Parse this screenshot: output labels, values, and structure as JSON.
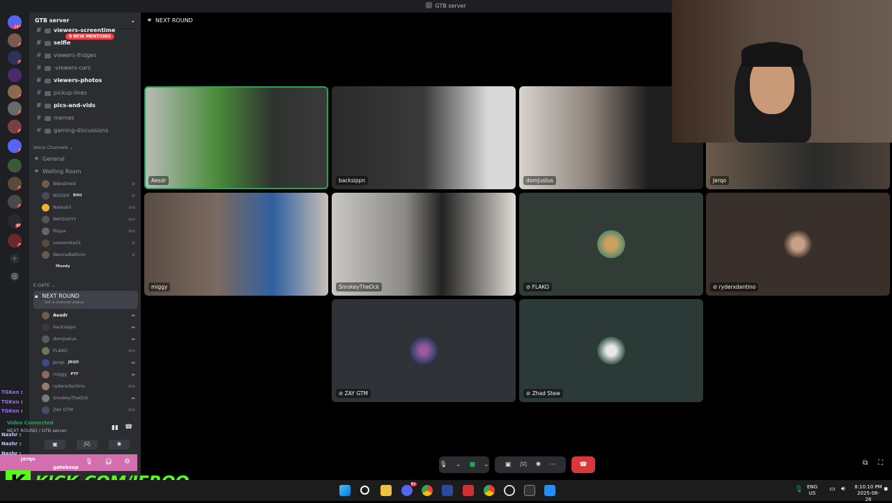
{
  "window": {
    "title": "GTB server"
  },
  "server": {
    "name": "GTB server",
    "new_mentions": "6 NEW MENTIONS"
  },
  "rail": {
    "badges": [
      "143",
      "4",
      "2",
      "",
      "2",
      "1",
      "6",
      "1",
      "",
      "1",
      "1",
      "84",
      "3"
    ],
    "add_label": "+"
  },
  "channels": [
    {
      "name": "viewers-screentime",
      "bold": true
    },
    {
      "name": "selfie",
      "bold": true
    },
    {
      "name": "viewers-fridges",
      "bold": false
    },
    {
      "name": "-viewers-cars",
      "bold": false
    },
    {
      "name": "viewers-photos",
      "bold": true
    },
    {
      "name": "pickup-lines",
      "bold": false
    },
    {
      "name": "pics-and-vids",
      "bold": true
    },
    {
      "name": "memes",
      "bold": false
    },
    {
      "name": "gaming-discussions",
      "bold": false
    }
  ],
  "voice_category": "Voice Channels",
  "voice_channels": {
    "general": "General",
    "waiting": "Waiting Room"
  },
  "waiting_members": [
    {
      "name": "Bdestined",
      "tag": ""
    },
    {
      "name": "BIGSIIX",
      "tag": "BAU"
    },
    {
      "name": "Nateskii",
      "tag": ""
    },
    {
      "name": "RAYSUVYY",
      "tag": ""
    },
    {
      "name": "Rique",
      "tag": ""
    },
    {
      "name": "useremka01",
      "tag": ""
    },
    {
      "name": "WannaBeElvin",
      "tag": ""
    },
    {
      "name": "Moody",
      "tag": ""
    }
  ],
  "edate_category": "E-DATE",
  "active_channel": {
    "name": "NEXT ROUND",
    "status": "Set a channel status"
  },
  "round_members": [
    {
      "name": "Aesdr",
      "tag": ""
    },
    {
      "name": "backsippn",
      "tag": ""
    },
    {
      "name": "domjustus",
      "tag": ""
    },
    {
      "name": "FLAKO",
      "tag": ""
    },
    {
      "name": "Jerqo",
      "tag": "JRQO"
    },
    {
      "name": "miggy",
      "tag": "PTF"
    },
    {
      "name": "ryderxdantino",
      "tag": ""
    },
    {
      "name": "SmokeyTheOck",
      "tag": ""
    },
    {
      "name": "ZAY GTM",
      "tag": ""
    }
  ],
  "user_panel": {
    "status": "Video Connected",
    "channel": "NEXT ROUND / GTB server",
    "username": "Jerqo",
    "activity": "gatekeep"
  },
  "chat_overlay": [
    {
      "user": "TGKen",
      "msg": ":"
    },
    {
      "user": "TGKen",
      "msg": ":"
    },
    {
      "user": "TGKen",
      "msg": ":"
    },
    {
      "user": "Nashr",
      "msg": ":"
    },
    {
      "user": "Nashr",
      "msg": ":"
    },
    {
      "user": "Nashr",
      "msg": ":"
    }
  ],
  "kick": {
    "logo": "K",
    "url": "KICK.COM/JERQO"
  },
  "stage": {
    "channel": "NEXT ROUND",
    "tiles": [
      {
        "name": "Aesdr",
        "video": true,
        "speaking": true,
        "color": "#6b6f63"
      },
      {
        "name": "backsippn",
        "video": true,
        "color": "#3a3a3a"
      },
      {
        "name": "domjustus",
        "video": true,
        "color": "#5e5a57"
      },
      {
        "name": "Jerqo",
        "video": true,
        "color": "#4a4038"
      },
      {
        "name": "miggy",
        "video": true,
        "color": "#5b4c43"
      },
      {
        "name": "SmokeyTheOck",
        "video": true,
        "color": "#8c8a86"
      },
      {
        "name": "FLAKO",
        "video": false,
        "color": "#313c36"
      },
      {
        "name": "ryderxdantino",
        "video": false,
        "color": "#3a302b"
      },
      {
        "name": "ZAY GTM",
        "video": false,
        "color": "#2f3338"
      },
      {
        "name": "Zhad Stew",
        "video": false,
        "color": "#2c3a37"
      }
    ]
  },
  "taskbar": {
    "lang": "ENG",
    "region": "US",
    "time": "8:10:10 PM",
    "date": "2025-08-26",
    "discord_badge": "9+"
  }
}
